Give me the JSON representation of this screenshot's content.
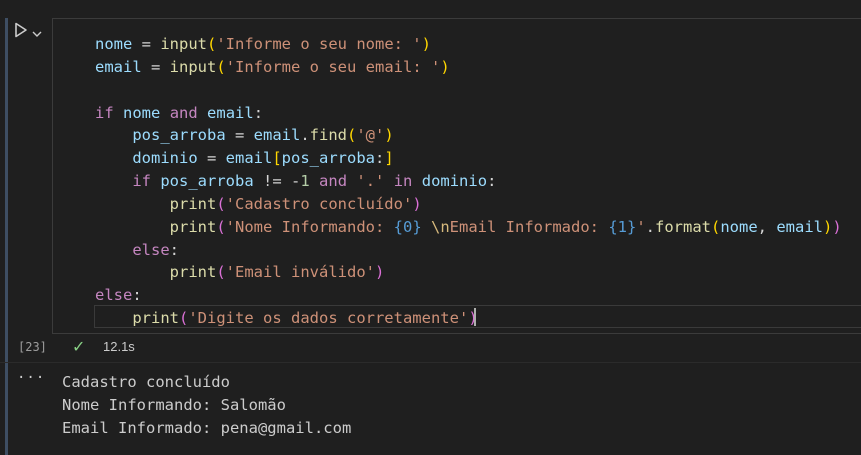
{
  "cell": {
    "execution_count": "[23]",
    "status_icon": "check-icon",
    "duration": "12.1s",
    "code_lines": [
      [
        [
          "var",
          "nome"
        ],
        [
          "op",
          " = "
        ],
        [
          "fn",
          "input"
        ],
        [
          "brk1",
          "("
        ],
        [
          "str",
          "'Informe o seu nome: '"
        ],
        [
          "brk1",
          ")"
        ]
      ],
      [
        [
          "var",
          "email"
        ],
        [
          "op",
          " = "
        ],
        [
          "fn",
          "input"
        ],
        [
          "brk1",
          "("
        ],
        [
          "str",
          "'Informe o seu email: '"
        ],
        [
          "brk1",
          ")"
        ]
      ],
      [],
      [
        [
          "kw",
          "if"
        ],
        [
          "op",
          " "
        ],
        [
          "var",
          "nome"
        ],
        [
          "op",
          " "
        ],
        [
          "kw",
          "and"
        ],
        [
          "op",
          " "
        ],
        [
          "var",
          "email"
        ],
        [
          "op",
          ":"
        ]
      ],
      [
        [
          "op",
          "    "
        ],
        [
          "var",
          "pos_arroba"
        ],
        [
          "op",
          " = "
        ],
        [
          "var",
          "email"
        ],
        [
          "op",
          "."
        ],
        [
          "fn",
          "find"
        ],
        [
          "brk1",
          "("
        ],
        [
          "str",
          "'@'"
        ],
        [
          "brk1",
          ")"
        ]
      ],
      [
        [
          "op",
          "    "
        ],
        [
          "var",
          "dominio"
        ],
        [
          "op",
          " = "
        ],
        [
          "var",
          "email"
        ],
        [
          "brk1",
          "["
        ],
        [
          "var",
          "pos_arroba"
        ],
        [
          "op",
          ":"
        ],
        [
          "brk1",
          "]"
        ]
      ],
      [
        [
          "op",
          "    "
        ],
        [
          "kw",
          "if"
        ],
        [
          "op",
          " "
        ],
        [
          "var",
          "pos_arroba"
        ],
        [
          "op",
          " != "
        ],
        [
          "op",
          "-"
        ],
        [
          "num",
          "1"
        ],
        [
          "op",
          " "
        ],
        [
          "kw",
          "and"
        ],
        [
          "op",
          " "
        ],
        [
          "str",
          "'.'"
        ],
        [
          "op",
          " "
        ],
        [
          "kw",
          "in"
        ],
        [
          "op",
          " "
        ],
        [
          "var",
          "dominio"
        ],
        [
          "op",
          ":"
        ]
      ],
      [
        [
          "op",
          "        "
        ],
        [
          "fn",
          "print"
        ],
        [
          "brk2",
          "("
        ],
        [
          "str",
          "'Cadastro concluído'"
        ],
        [
          "brk2",
          ")"
        ]
      ],
      [
        [
          "op",
          "        "
        ],
        [
          "fn",
          "print"
        ],
        [
          "brk2",
          "("
        ],
        [
          "str",
          "'Nome Informando: "
        ],
        [
          "fmt",
          "{0}"
        ],
        [
          "str",
          " "
        ],
        [
          "esc",
          "\\n"
        ],
        [
          "str",
          "Email Informado: "
        ],
        [
          "fmt",
          "{1}"
        ],
        [
          "str",
          "'"
        ],
        [
          "op",
          "."
        ],
        [
          "fn",
          "format"
        ],
        [
          "brk1",
          "("
        ],
        [
          "var",
          "nome"
        ],
        [
          "op",
          ", "
        ],
        [
          "var",
          "email"
        ],
        [
          "brk1",
          ")"
        ],
        [
          "brk2",
          ")"
        ]
      ],
      [
        [
          "op",
          "    "
        ],
        [
          "kw",
          "else"
        ],
        [
          "op",
          ":"
        ]
      ],
      [
        [
          "op",
          "        "
        ],
        [
          "fn",
          "print"
        ],
        [
          "brk2",
          "("
        ],
        [
          "str",
          "'Email inválido'"
        ],
        [
          "brk2",
          ")"
        ]
      ],
      [
        [
          "kw",
          "else"
        ],
        [
          "op",
          ":"
        ]
      ],
      [
        [
          "op",
          "    "
        ],
        [
          "fn",
          "print"
        ],
        [
          "brk2",
          "("
        ],
        [
          "str",
          "'Digite os dados corretamente'"
        ],
        [
          "brk2",
          ")"
        ]
      ]
    ]
  },
  "output": {
    "menu_label": "···",
    "lines": [
      "Cadastro concluído",
      "Nome Informando: Salomão",
      "Email Informado: pena@gmail.com"
    ]
  },
  "colors": {
    "background": "#1f1f1f",
    "keyword": "#c586c0",
    "string": "#ce9178",
    "function": "#dcdcaa",
    "variable": "#9cdcfe",
    "success": "#89d185"
  }
}
